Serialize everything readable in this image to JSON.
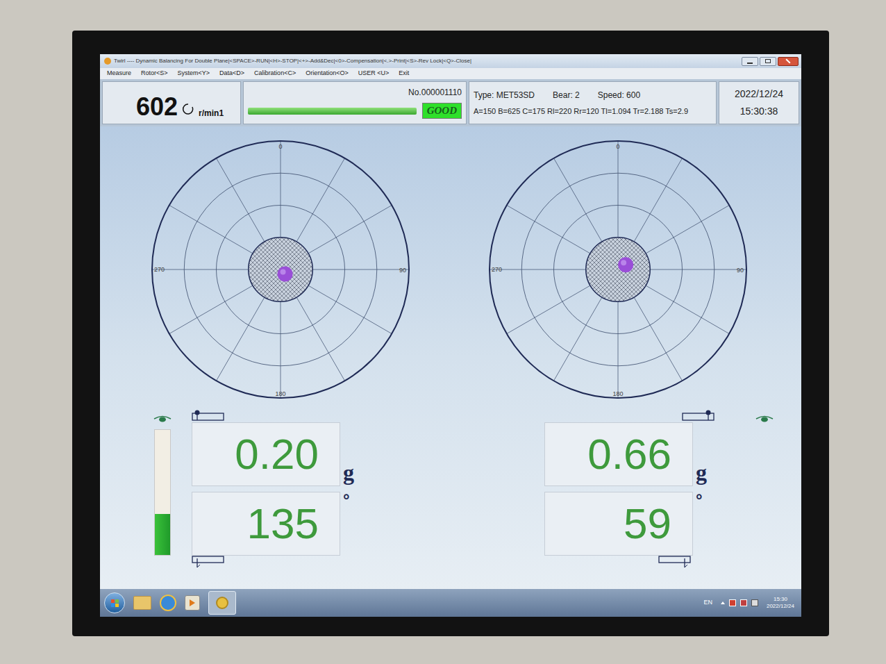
{
  "window": {
    "title": "Twirl ---- Dynamic Balancing For Double Plane|<SPACE>-RUN|<H>-STOP|<+>-Add&Dec|<0>-Compensation|<.>-Print|<S>-Rev Lock|<Q>-Close|"
  },
  "menu": [
    "Measure",
    "Rotor<S>",
    "System<Y>",
    "Data<D>",
    "Calibration<C>",
    "Orientation<O>",
    "USER <U>",
    "Exit"
  ],
  "header": {
    "speed": "602",
    "speed_unit": "r/min1",
    "record_no": "No.000001110",
    "progress_level": 1,
    "status": "GOOD",
    "type": "Type: MET53SD",
    "bear": "Bear: 2",
    "set_speed": "Speed: 600",
    "params": "A=150 B=625 C=175 Rl=220 Rr=120 Tl=1.094 Tr=2.188 Ts=2.9",
    "date": "2022/12/24",
    "time": "15:30:38"
  },
  "plots": [
    {
      "name": "left",
      "axis_labels": [
        "0",
        "90",
        "180",
        "270"
      ],
      "tolerance_level": 0.25,
      "marker_level": 0.05,
      "weight": "0.20",
      "weight_unit": "g",
      "angle": "135",
      "angle_unit": "°",
      "meter_level": 0.33
    },
    {
      "name": "right",
      "axis_labels": [
        "0",
        "90",
        "180",
        "270"
      ],
      "tolerance_level": 0.25,
      "marker_level": 0.07,
      "weight": "0.66",
      "weight_unit": "g",
      "angle": "59",
      "angle_unit": "°"
    }
  ],
  "taskbar": {
    "language": "EN",
    "clock_time": "15:30",
    "clock_date": "2022/12/24"
  }
}
